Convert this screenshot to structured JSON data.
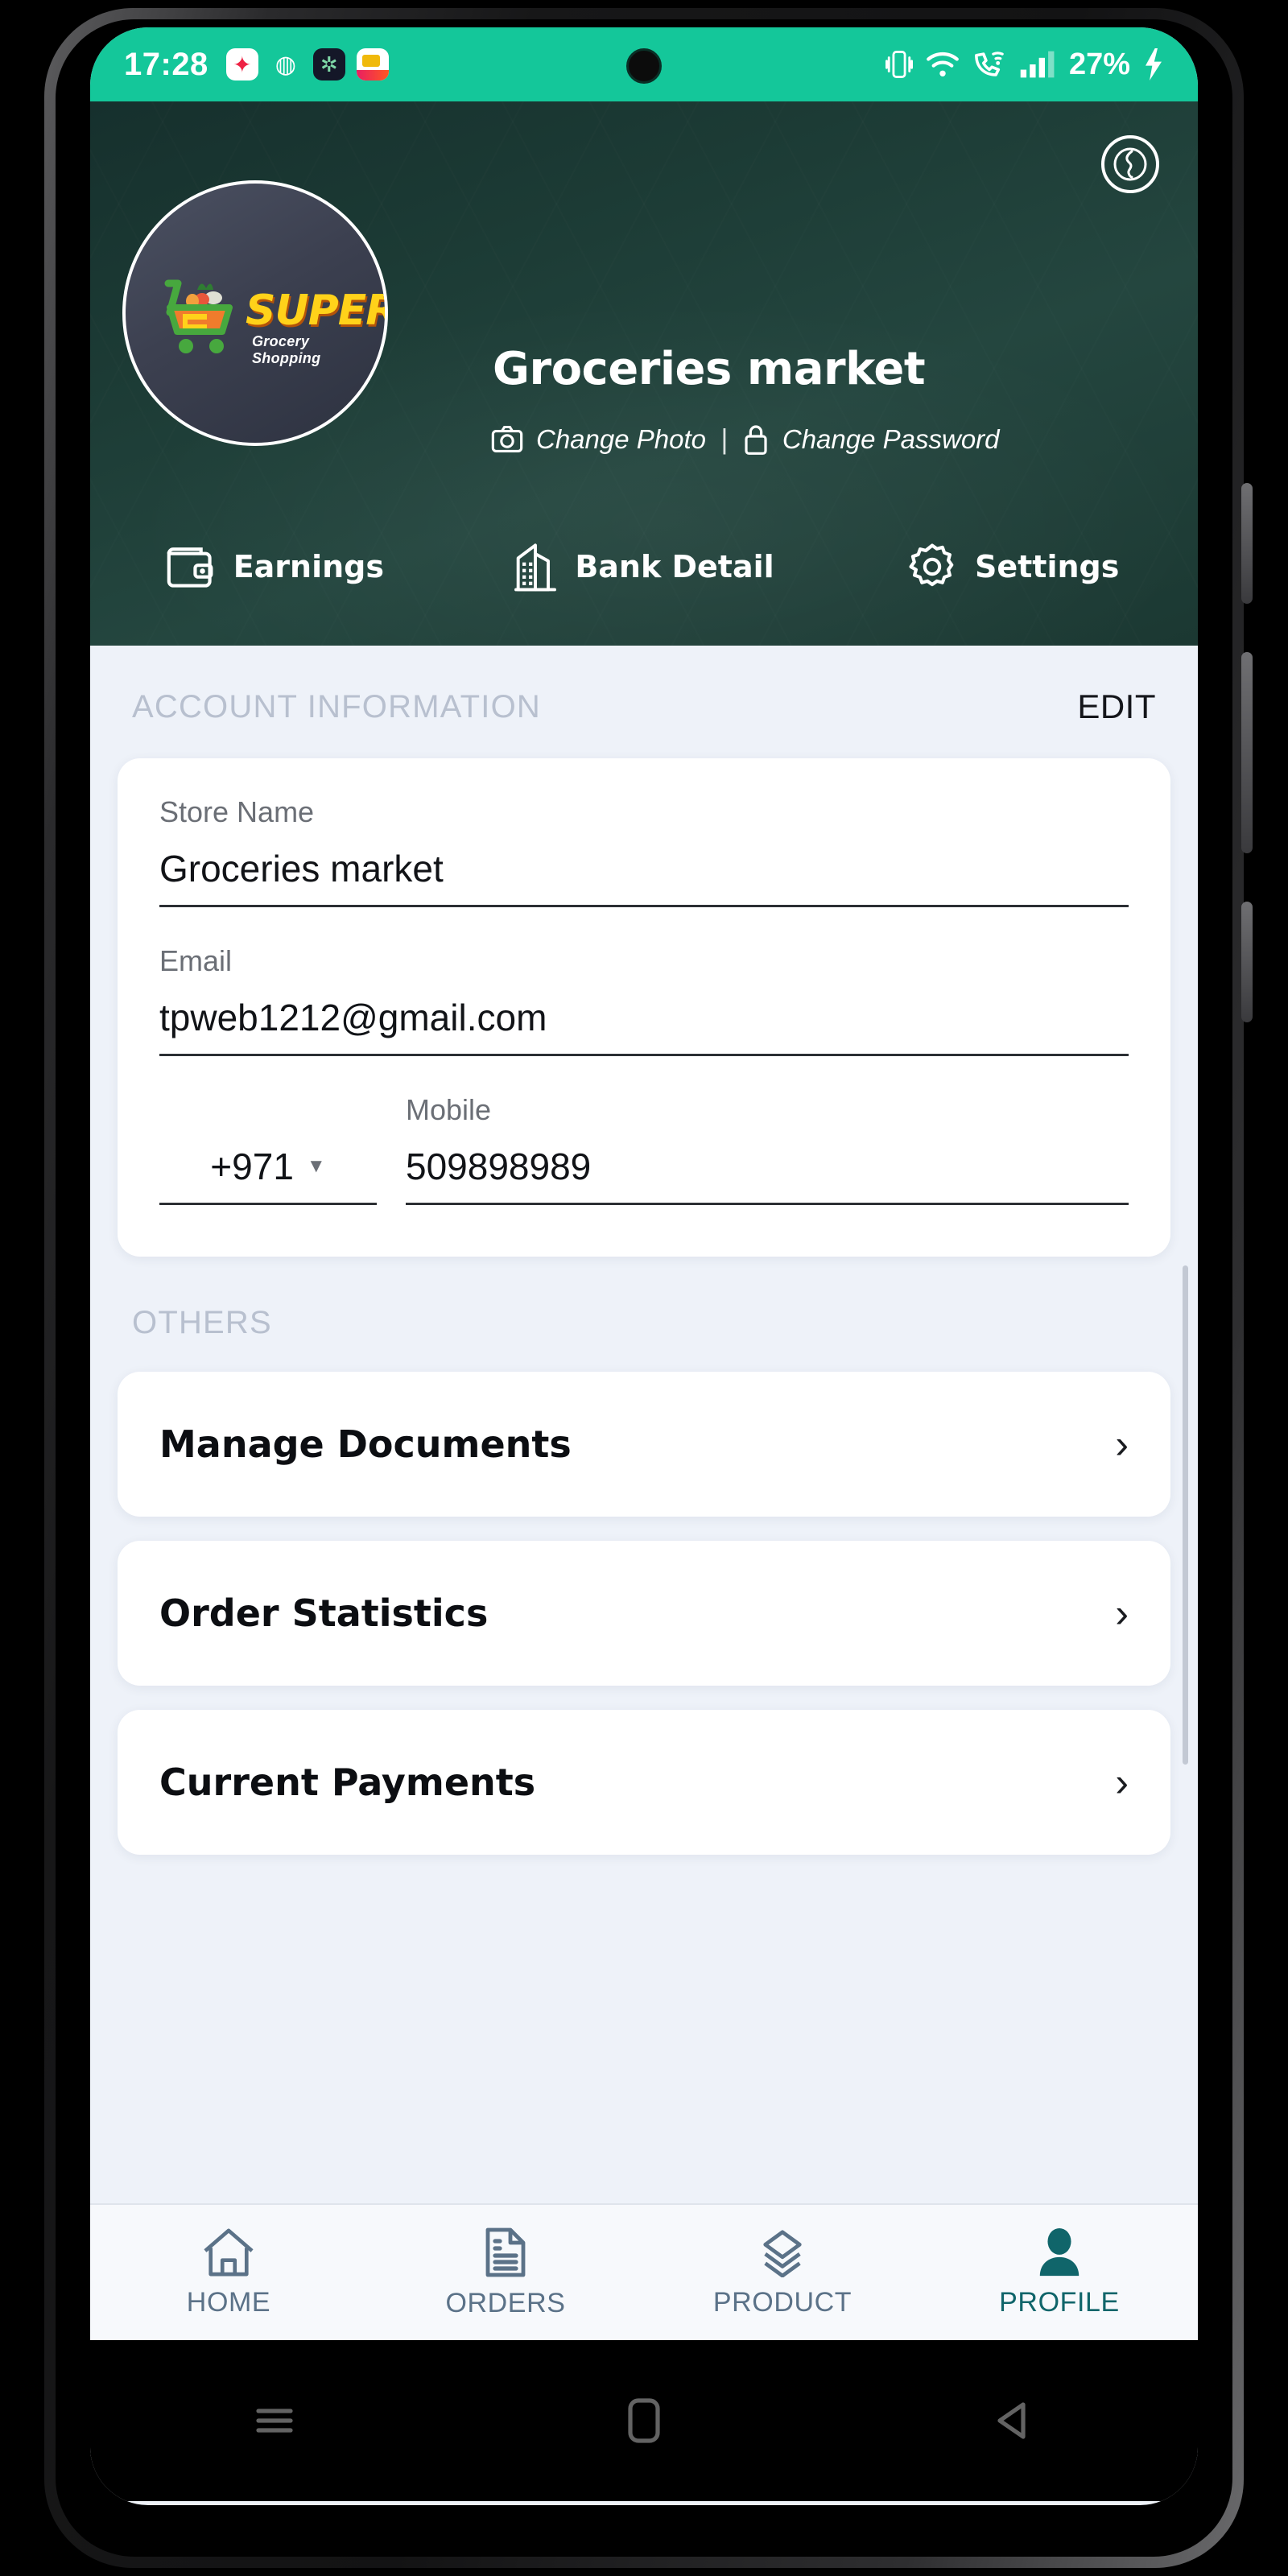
{
  "status_bar": {
    "time": "17:28",
    "tray_icons": [
      "photos-app-icon",
      "location-icon",
      "dark-app-icon",
      "sale-app-icon"
    ],
    "right_icons": [
      "vibrate-icon",
      "wifi-icon",
      "wifi-calling-icon",
      "signal-bars-icon",
      "charging-bolt-icon"
    ],
    "battery": "27%"
  },
  "header": {
    "store_name": "Groceries market",
    "globe_icon": "globe-icon",
    "avatar": {
      "logo_word": "SUPER",
      "logo_tagline": "Grocery Shopping",
      "cart_icon": "shopping-cart-icon"
    },
    "links": [
      {
        "label": "Change Photo",
        "icon": "camera-icon"
      },
      {
        "label": "Change Password",
        "icon": "lock-icon"
      }
    ],
    "separator": "|",
    "actions": [
      {
        "label": "Earnings",
        "icon": "wallet-icon"
      },
      {
        "label": "Bank Detail",
        "icon": "building-icon"
      },
      {
        "label": "Settings",
        "icon": "gear-icon"
      }
    ]
  },
  "account_section": {
    "title": "ACCOUNT INFORMATION",
    "edit_label": "EDIT",
    "fields": [
      {
        "label": "Store Name",
        "value": "Groceries market"
      },
      {
        "label": "Email",
        "value": "tpweb1212@gmail.com"
      }
    ],
    "mobile": {
      "label": "Mobile",
      "country_code": "+971",
      "caret": "▼",
      "value": "509898989"
    }
  },
  "others_section": {
    "title": "OTHERS",
    "rows": [
      {
        "label": "Manage Documents",
        "chevron": "›"
      },
      {
        "label": "Order Statistics",
        "chevron": "›"
      },
      {
        "label": "Current Payments",
        "chevron": "›"
      }
    ]
  },
  "bottom_nav": {
    "items": [
      {
        "label": "HOME",
        "icon": "home-icon",
        "active": false
      },
      {
        "label": "ORDERS",
        "icon": "document-icon",
        "active": false
      },
      {
        "label": "PRODUCT",
        "icon": "layers-icon",
        "active": false
      },
      {
        "label": "PROFILE",
        "icon": "person-icon",
        "active": true
      }
    ]
  },
  "android_nav": {
    "buttons": [
      "recents-icon",
      "home-square-icon",
      "back-triangle-icon"
    ]
  },
  "colors": {
    "status_green": "#14c79a",
    "header_dark": "#1c3b35",
    "accent_teal": "#10656a",
    "nav_inactive": "#5b7288",
    "page_bg": "#eef2f9"
  }
}
